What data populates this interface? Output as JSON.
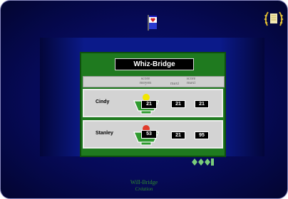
{
  "app": {
    "title": "Whiz-Bridge",
    "brand_name": "Will-Bridge",
    "brand_subtitle": "Création"
  },
  "table_header": {
    "avg_score": "score moyen",
    "max_score": "score maxi",
    "max_label": "maxi"
  },
  "players": [
    {
      "name": "Cindy",
      "avg_score": "21",
      "val1": "21",
      "val2": "21",
      "indicator_color": "#f2e600"
    },
    {
      "name": "Stanley",
      "avg_score": "53",
      "val1": "21",
      "val2": "95",
      "indicator_color": "#e03b2b"
    }
  ],
  "colors": {
    "panel_green": "#1f7a1f",
    "trophy_green": "#2f9a2f",
    "background_navy": "#060a58"
  }
}
